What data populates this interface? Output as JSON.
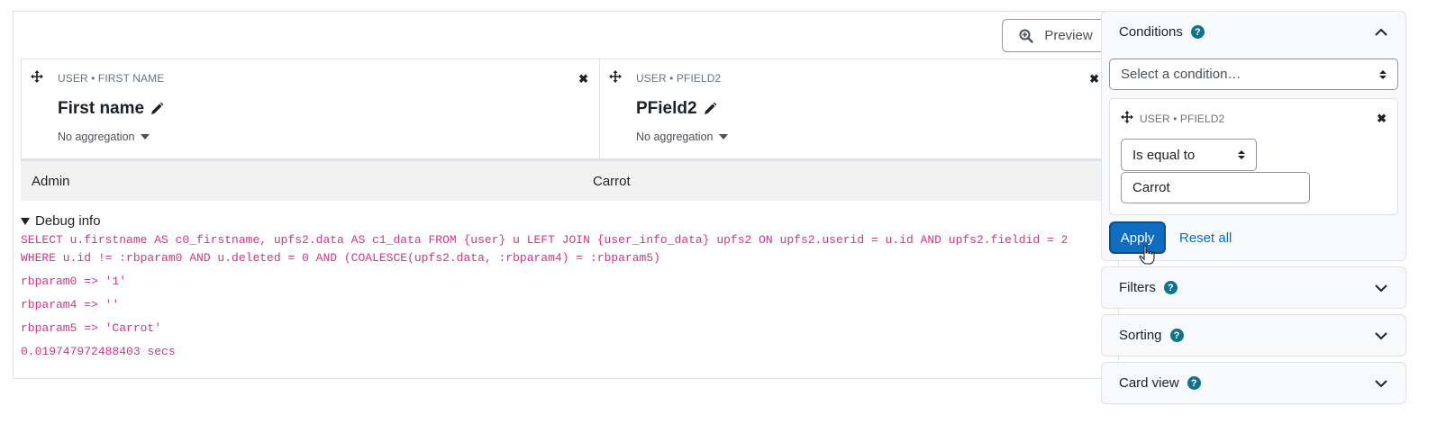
{
  "toolbar": {
    "preview_label": "Preview"
  },
  "columns": [
    {
      "meta": "USER • FIRST NAME",
      "title": "First name",
      "aggregation": "No aggregation"
    },
    {
      "meta": "USER • PFIELD2",
      "title": "PField2",
      "aggregation": "No aggregation"
    }
  ],
  "rows": [
    [
      "Admin",
      "Carrot"
    ]
  ],
  "debug": {
    "title": "Debug info",
    "sql_line1": "SELECT u.firstname AS c0_firstname, upfs2.data AS c1_data FROM {user} u LEFT JOIN {user_info_data} upfs2 ON upfs2.userid = u.id AND upfs2.fieldid = 2",
    "sql_line2": "WHERE u.id != :rbparam0 AND u.deleted = 0 AND (COALESCE(upfs2.data, :rbparam4) = :rbparam5)",
    "params": [
      "rbparam0 => '1'",
      "rbparam4 => ''",
      "rbparam5 => 'Carrot'"
    ],
    "time": "0.019747972488403 secs"
  },
  "sidebar": {
    "conditions": {
      "title": "Conditions",
      "select_placeholder": "Select a condition…",
      "condition": {
        "meta": "USER • PFIELD2",
        "operator": "Is equal to",
        "value": "Carrot"
      },
      "apply_label": "Apply",
      "reset_label": "Reset all"
    },
    "filters_title": "Filters",
    "sorting_title": "Sorting",
    "cardview_title": "Card view",
    "help_glyph": "?"
  },
  "colors": {
    "primary": "#0f6cbf",
    "debug_text": "#d63384",
    "help_icon": "#127287"
  },
  "icons": [
    "move-icon",
    "close-icon",
    "pencil-icon",
    "caret-down-icon",
    "zoom-in-icon",
    "help-icon",
    "chevron-up-icon",
    "chevron-down-icon",
    "pointer-cursor-icon"
  ]
}
